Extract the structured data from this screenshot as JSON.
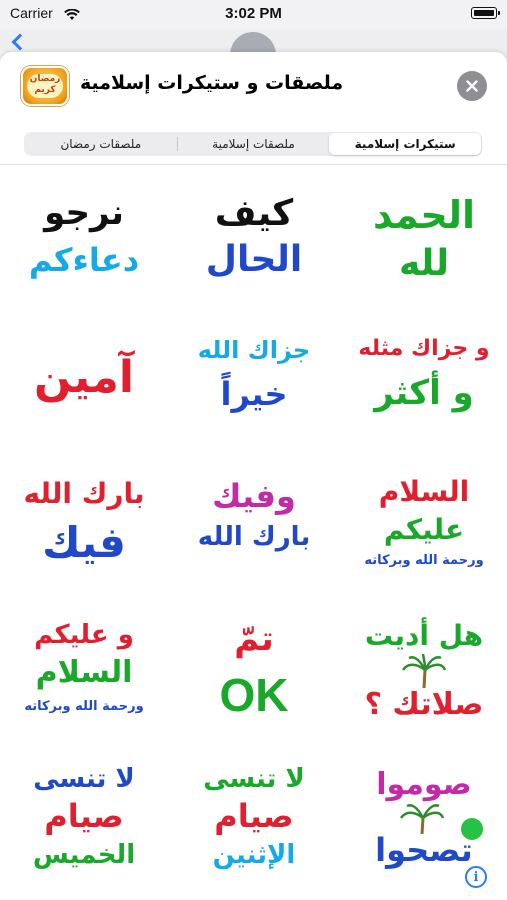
{
  "status_bar": {
    "carrier": "Carrier",
    "time": "3:02 PM"
  },
  "sheet": {
    "title": "ملصقات و ستيكرات إسلامية",
    "app_icon_text": "رمضان كريم"
  },
  "tabs": [
    {
      "label": "ستيكرات إسلامية",
      "active": true
    },
    {
      "label": "ملصقات إسلامية",
      "active": false
    },
    {
      "label": "ملصقات رمضان",
      "active": false
    }
  ],
  "stickers": [
    {
      "lines": [
        "الحمد",
        "لله"
      ]
    },
    {
      "lines": [
        "كيف",
        "الحال"
      ]
    },
    {
      "lines": [
        "نرجو",
        "دعاءكم"
      ]
    },
    {
      "lines": [
        "و جزاك مثله",
        "و أكثر"
      ]
    },
    {
      "lines": [
        "جزاك الله",
        "خيراً"
      ]
    },
    {
      "lines": [
        "آمين"
      ]
    },
    {
      "lines": [
        "السلام",
        "عليكم",
        "ورحمة الله وبركاته"
      ]
    },
    {
      "lines": [
        "وفيك",
        "بارك الله"
      ]
    },
    {
      "lines": [
        "بارك الله",
        "فيك"
      ]
    },
    {
      "lines": [
        "هل أديت",
        "صلاتك ؟"
      ]
    },
    {
      "lines": [
        "تمّ",
        "OK"
      ]
    },
    {
      "lines": [
        "و عليكم",
        "السلام",
        "ورحمة الله وبركاته"
      ]
    },
    {
      "lines": [
        "صوموا",
        "تصحوا"
      ]
    },
    {
      "lines": [
        "لا تنسى",
        "صيام",
        "الإثنين"
      ]
    },
    {
      "lines": [
        "لا تنسى",
        "صيام",
        "الخميس"
      ]
    }
  ],
  "colors": {
    "green": "#1aa82a",
    "blue": "#1f49c8",
    "black": "#111111",
    "red": "#e0202f",
    "cyan": "#16a9e8",
    "magenta": "#c42aa6",
    "accent": "#2b7cf7"
  }
}
